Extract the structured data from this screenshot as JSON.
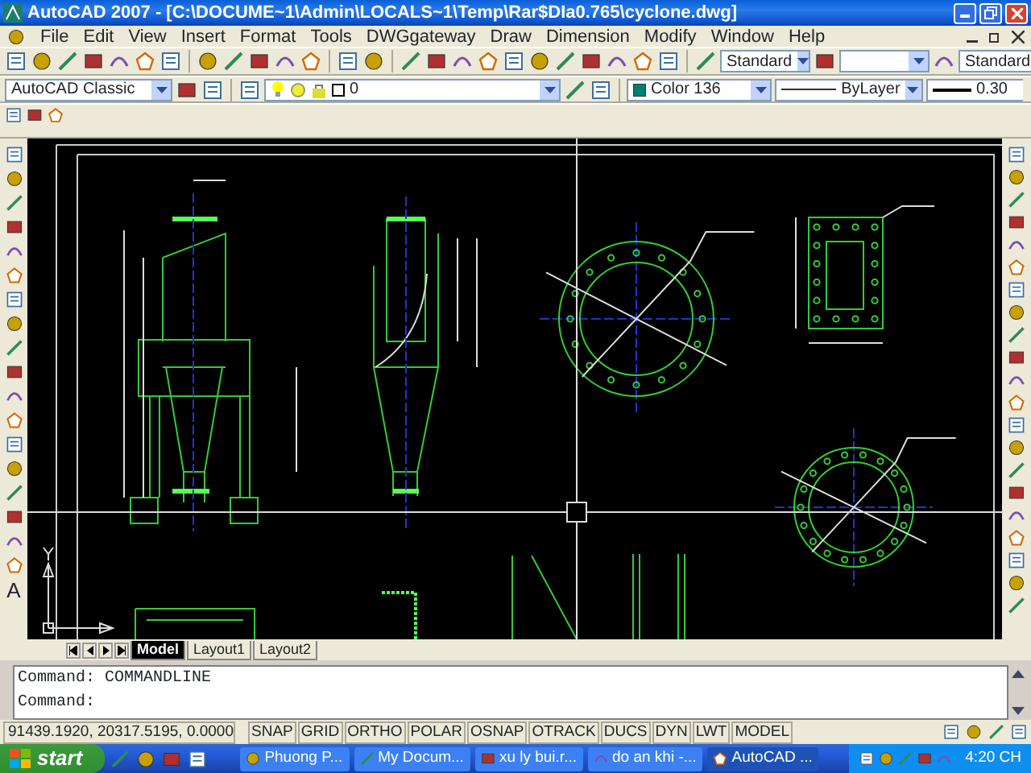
{
  "window": {
    "title": "AutoCAD 2007 - [C:\\DOCUME~1\\Admin\\LOCALS~1\\Temp\\Rar$DIa0.765\\cyclone.dwg]"
  },
  "menu": [
    "File",
    "Edit",
    "View",
    "Insert",
    "Format",
    "Tools",
    "DWGgateway",
    "Draw",
    "Dimension",
    "Modify",
    "Window",
    "Help"
  ],
  "styles_toolbar": {
    "text_style": "Standard",
    "table_style": "Standard"
  },
  "workspace": "AutoCAD Classic",
  "layers_toolbar": {
    "layer": "0"
  },
  "properties_toolbar": {
    "color_label": "Color 136",
    "linetype": "ByLayer",
    "lineweight": "0.30"
  },
  "draw_toolbar": {
    "text_glyph": "A"
  },
  "layout_tabs": [
    {
      "label": "Model",
      "selected": true
    },
    {
      "label": "Layout1",
      "selected": false
    },
    {
      "label": "Layout2",
      "selected": false
    }
  ],
  "command_lines": [
    "Command: COMMANDLINE",
    "Command:"
  ],
  "status_bar": {
    "coordinates": "91439.1920, 20317.5195, 0.0000",
    "toggles": [
      "SNAP",
      "GRID",
      "ORTHO",
      "POLAR",
      "OSNAP",
      "OTRACK",
      "DUCS",
      "DYN",
      "LWT",
      "MODEL"
    ]
  },
  "taskbar": {
    "start": "start",
    "tasks": [
      {
        "label": "Phuong P...",
        "selected": false
      },
      {
        "label": "My Docum...",
        "selected": false
      },
      {
        "label": "xu ly bui.r...",
        "selected": false
      },
      {
        "label": "do an khi -...",
        "selected": false
      },
      {
        "label": "AutoCAD ...",
        "selected": true
      }
    ],
    "clock": "4:20 CH"
  }
}
